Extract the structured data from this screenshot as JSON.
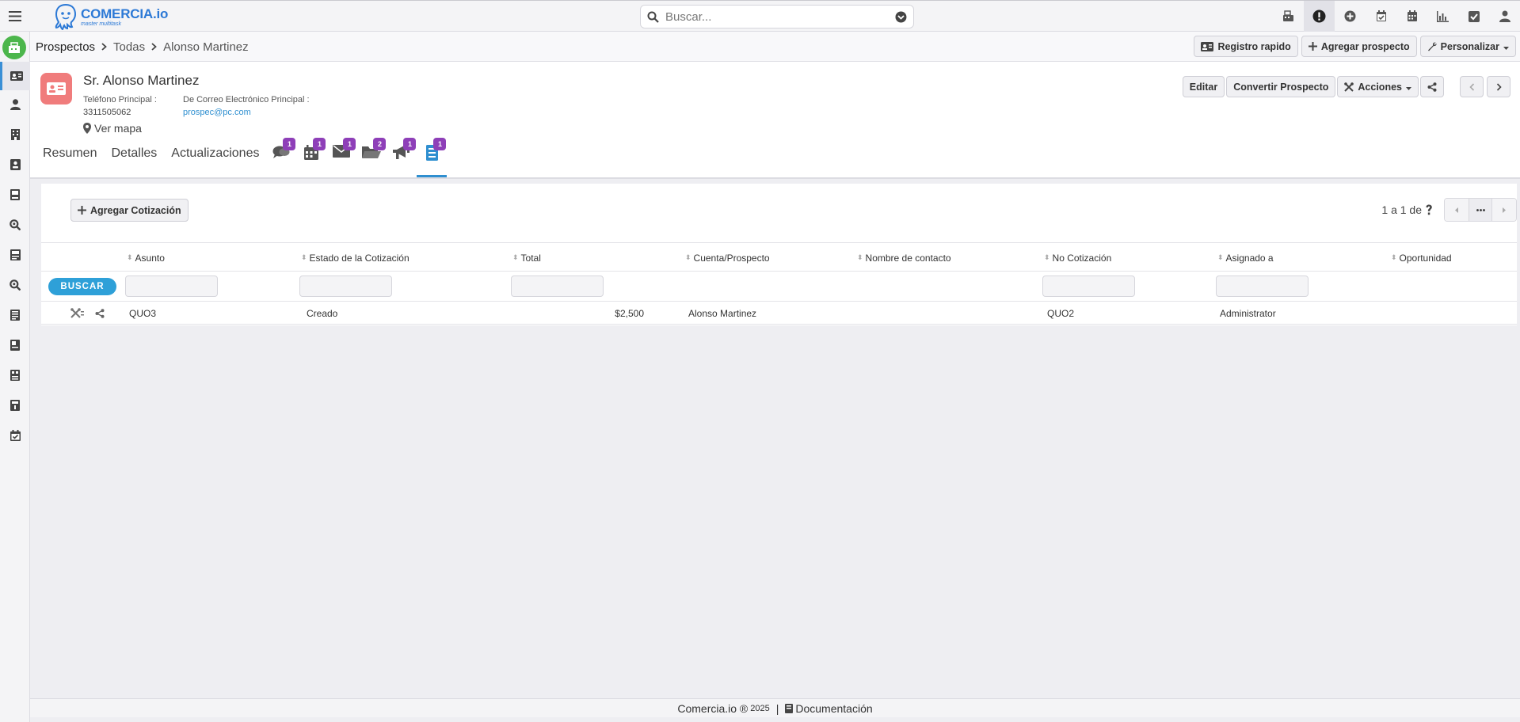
{
  "brand": {
    "name": "COMERCIA.io",
    "tagline": "master multitask",
    "color": "#2c79d6"
  },
  "search": {
    "placeholder": "Buscar..."
  },
  "top_icons": [
    "register-icon",
    "alert-icon",
    "plus-circle-icon",
    "calendar-check-icon",
    "calendar-icon",
    "chart-icon",
    "checkbox-icon",
    "user-icon"
  ],
  "breadcrumb": {
    "module": "Prospectos",
    "list": "Todas",
    "record": "Alonso Martinez"
  },
  "header_actions": {
    "quick": "Registro rapido",
    "add": "Agregar prospecto",
    "customize": "Personalizar"
  },
  "record": {
    "title": "Sr. Alonso Martinez",
    "phone_label": "Teléfono Principal :",
    "phone": "3311505062",
    "email_label": "De Correo Electrónico Principal :",
    "email": "prospec@pc.com",
    "map": "Ver mapa",
    "actions": {
      "edit": "Editar",
      "convert": "Convertir Prospecto",
      "actions": "Acciones"
    }
  },
  "tabs": {
    "summary": "Resumen",
    "details": "Detalles",
    "updates": "Actualizaciones",
    "badges": {
      "comments": "1",
      "events": "1",
      "emails": "1",
      "documents": "2",
      "campaigns": "1",
      "quotes": "1"
    }
  },
  "quotes": {
    "add_button": "Agregar Cotización",
    "pager": "1 a 1  de",
    "filter_button": "BUSCAR",
    "columns": [
      "Asunto",
      "Estado de la Cotización",
      "Total",
      "Cuenta/Prospecto",
      "Nombre de contacto",
      "No Cotización",
      "Asignado a",
      "Oportunidad"
    ],
    "rows": [
      {
        "subject": "QUO3",
        "status": "Creado",
        "total": "$2,500",
        "account": "Alonso Martinez",
        "contact": "",
        "number": "QUO2",
        "assigned": "Administrator",
        "opportunity": ""
      }
    ]
  },
  "footer": {
    "brand": "Comercia.io ®",
    "year": "2025",
    "docs": "Documentación"
  },
  "colors": {
    "accent": "#2f8fd0",
    "badge": "#8e3fb8",
    "avatar": "#f07c7c",
    "home": "#4cb64c"
  }
}
